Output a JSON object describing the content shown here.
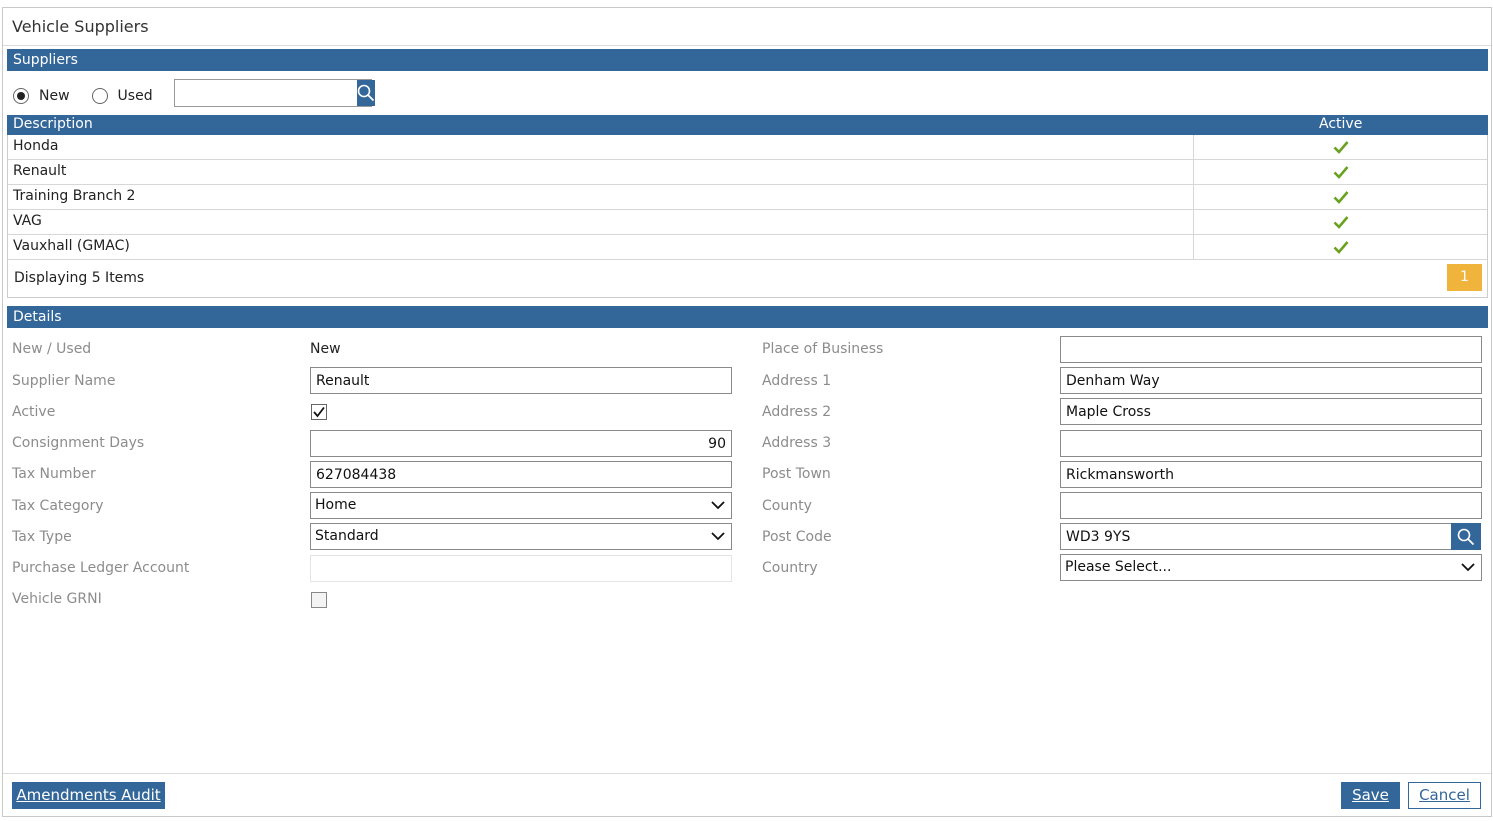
{
  "window": {
    "title": "Vehicle Suppliers"
  },
  "suppliers": {
    "section_label": "Suppliers",
    "filter": {
      "options": [
        {
          "label": "New",
          "checked": true
        },
        {
          "label": "Used",
          "checked": false
        }
      ],
      "search_value": "",
      "search_icon": "search-icon"
    },
    "columns": {
      "description": "Description",
      "active": "Active"
    },
    "rows": [
      {
        "description": "Honda",
        "active": true
      },
      {
        "description": "Renault",
        "active": true
      },
      {
        "description": "Training Branch 2",
        "active": true
      },
      {
        "description": "VAG",
        "active": true
      },
      {
        "description": "Vauxhall (GMAC)",
        "active": true
      }
    ],
    "count_text": "Displaying 5 Items",
    "page": "1"
  },
  "details": {
    "section_label": "Details",
    "left": {
      "new_used": {
        "label": "New / Used",
        "value": "New"
      },
      "supplier_name": {
        "label": "Supplier Name",
        "value": "Renault"
      },
      "active": {
        "label": "Active",
        "checked": true
      },
      "consignment_days": {
        "label": "Consignment Days",
        "value": "90"
      },
      "tax_number": {
        "label": "Tax Number",
        "value": "627084438"
      },
      "tax_category": {
        "label": "Tax Category",
        "value": "Home"
      },
      "tax_type": {
        "label": "Tax Type",
        "value": "Standard"
      },
      "purchase_ledger": {
        "label": "Purchase Ledger Account",
        "value": ""
      },
      "vehicle_grni": {
        "label": "Vehicle GRNI",
        "checked": false
      }
    },
    "right": {
      "place_of_business": {
        "label": "Place of Business",
        "value": ""
      },
      "address1": {
        "label": "Address 1",
        "value": "Denham Way"
      },
      "address2": {
        "label": "Address 2",
        "value": "Maple Cross"
      },
      "address3": {
        "label": "Address 3",
        "value": ""
      },
      "post_town": {
        "label": "Post Town",
        "value": "Rickmansworth"
      },
      "county": {
        "label": "County",
        "value": ""
      },
      "post_code": {
        "label": "Post Code",
        "value": "WD3 9YS"
      },
      "country": {
        "label": "Country",
        "value": "Please Select..."
      }
    }
  },
  "footer": {
    "audit_label": "Amendments Audit",
    "save_label": "Save",
    "cancel_label": "Cancel"
  },
  "colors": {
    "accent": "#336699",
    "check_green": "#6aa121",
    "pager": "#f0b43c"
  }
}
